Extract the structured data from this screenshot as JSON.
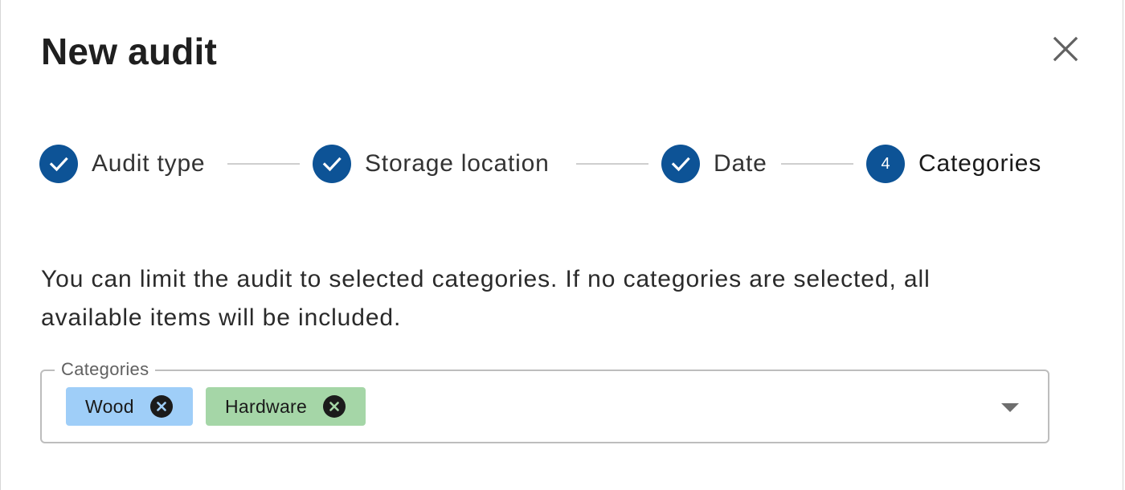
{
  "dialog": {
    "title": "New audit",
    "close_icon": "close-icon"
  },
  "stepper": {
    "accent_color": "#0d5396",
    "steps": [
      {
        "label": "Audit type",
        "state": "completed",
        "icon": "check-icon"
      },
      {
        "label": "Storage location",
        "state": "completed",
        "icon": "check-icon"
      },
      {
        "label": "Date",
        "state": "completed",
        "icon": "check-icon"
      },
      {
        "label": "Categories",
        "state": "active",
        "number": "4"
      }
    ]
  },
  "description": "You can limit the audit to selected categories. If no categories are selected, all available items will be included.",
  "categories_field": {
    "label": "Categories",
    "chips": [
      {
        "label": "Wood",
        "color": "#9fcef8",
        "remove_icon": "remove-circle-icon"
      },
      {
        "label": "Hardware",
        "color": "#a5d6a7",
        "remove_icon": "remove-circle-icon"
      }
    ],
    "dropdown_icon": "chevron-down-icon"
  }
}
